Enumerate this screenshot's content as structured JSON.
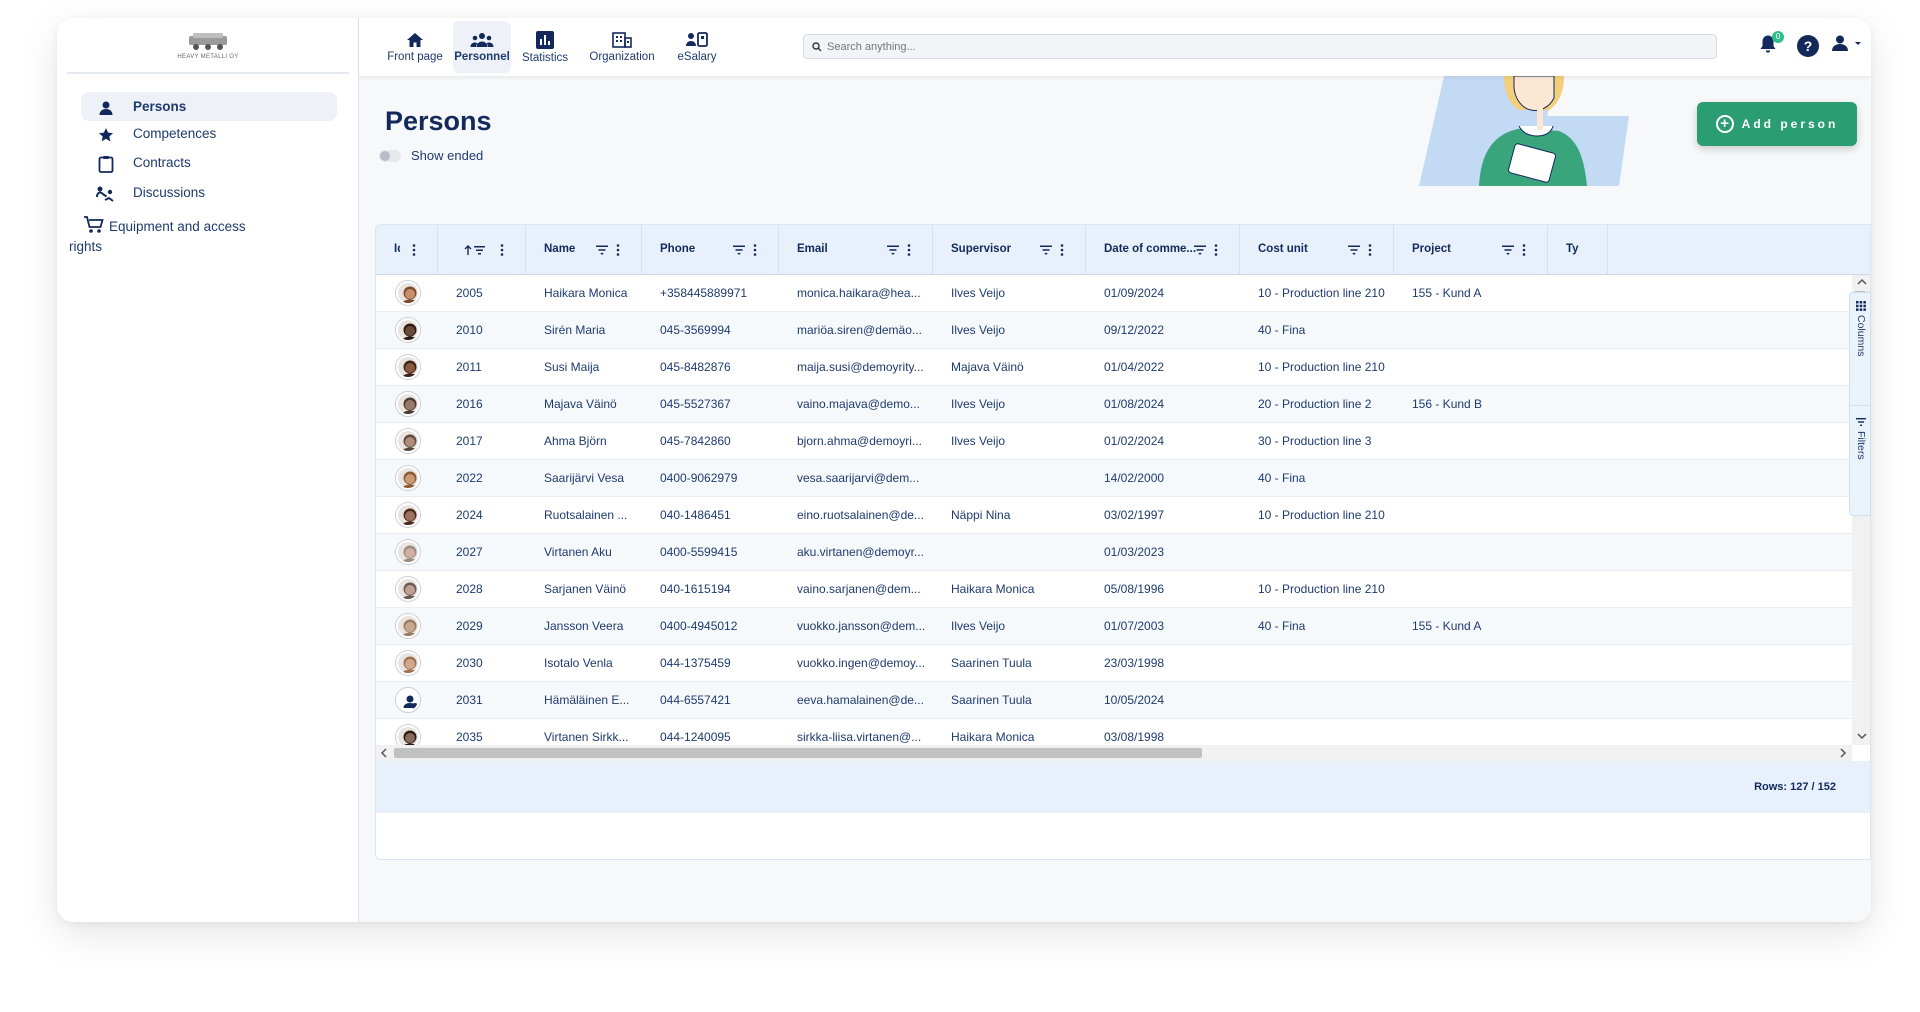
{
  "app": {
    "logo_text": "HEAVY METALLI OY"
  },
  "sidebar": {
    "items": [
      {
        "label": "Persons",
        "icon": "person-icon",
        "active": true
      },
      {
        "label": "Competences",
        "icon": "star-icon",
        "active": false
      },
      {
        "label": "Contracts",
        "icon": "clipboard-icon",
        "active": false
      },
      {
        "label": "Discussions",
        "icon": "chat-icon",
        "active": false
      },
      {
        "label": "Equipment and access rights",
        "icon": "cart-icon",
        "active": false
      }
    ]
  },
  "topnav": {
    "items": [
      {
        "label": "Front page",
        "icon": "home-icon"
      },
      {
        "label": "Personnel",
        "icon": "people-icon",
        "active": true
      },
      {
        "label": "Statistics",
        "icon": "bar-chart-icon"
      },
      {
        "label": "Organization",
        "icon": "building-icon"
      },
      {
        "label": "eSalary",
        "icon": "salary-icon"
      }
    ],
    "search_placeholder": "Search anything...",
    "notification_count": "0"
  },
  "page": {
    "title": "Persons",
    "show_ended_label": "Show ended",
    "add_person_label": "Add person"
  },
  "table": {
    "columns": [
      "Id",
      "",
      "Name",
      "Phone",
      "Email",
      "Supervisor",
      "Date of comme...",
      "Cost unit",
      "Project",
      "Ty"
    ],
    "rows": [
      {
        "no": "2005",
        "name": "Haikara Monica",
        "phone": "+358445889971",
        "email": "monica.haikara@hea...",
        "supervisor": "Ilves Veijo",
        "date": "01/09/2024",
        "cost": "10 - Production line 210",
        "project": "155 - Kund A"
      },
      {
        "no": "2010",
        "name": "Sirén Maria",
        "phone": "045-3569994",
        "email": "mariöa.siren@demäo...",
        "supervisor": "Ilves Veijo",
        "date": "09/12/2022",
        "cost": "40 - Fina",
        "project": ""
      },
      {
        "no": "2011",
        "name": "Susi Maija",
        "phone": "045-8482876",
        "email": "maija.susi@demoyrity...",
        "supervisor": "Majava Väinö",
        "date": "01/04/2022",
        "cost": "10 - Production line 210",
        "project": ""
      },
      {
        "no": "2016",
        "name": "Majava Väinö",
        "phone": "045-5527367",
        "email": "vaino.majava@demo...",
        "supervisor": "Ilves Veijo",
        "date": "01/08/2024",
        "cost": "20 - Production line 2",
        "project": "156 - Kund B"
      },
      {
        "no": "2017",
        "name": "Ahma Björn",
        "phone": "045-7842860",
        "email": "bjorn.ahma@demoyri...",
        "supervisor": "Ilves Veijo",
        "date": "01/02/2024",
        "cost": "30 - Production line 3",
        "project": ""
      },
      {
        "no": "2022",
        "name": "Saarijärvi Vesa",
        "phone": "0400-9062979",
        "email": "vesa.saarijarvi@dem...",
        "supervisor": "",
        "date": "14/02/2000",
        "cost": "40 - Fina",
        "project": ""
      },
      {
        "no": "2024",
        "name": "Ruotsalainen ...",
        "phone": "040-1486451",
        "email": "eino.ruotsalainen@de...",
        "supervisor": "Näppi Nina",
        "date": "03/02/1997",
        "cost": "10 - Production line 210",
        "project": ""
      },
      {
        "no": "2027",
        "name": "Virtanen Aku",
        "phone": "0400-5599415",
        "email": "aku.virtanen@demoyr...",
        "supervisor": "",
        "date": "01/03/2023",
        "cost": "",
        "project": ""
      },
      {
        "no": "2028",
        "name": "Sarjanen Väinö",
        "phone": "040-1615194",
        "email": "vaino.sarjanen@dem...",
        "supervisor": "Haikara Monica",
        "date": "05/08/1996",
        "cost": "10 - Production line 210",
        "project": ""
      },
      {
        "no": "2029",
        "name": "Jansson Veera",
        "phone": "0400-4945012",
        "email": "vuokko.jansson@dem...",
        "supervisor": "Ilves Veijo",
        "date": "01/07/2003",
        "cost": "40 - Fina",
        "project": "155 - Kund A"
      },
      {
        "no": "2030",
        "name": "Isotalo Venla",
        "phone": "044-1375459",
        "email": "vuokko.ingen@demoy...",
        "supervisor": "Saarinen Tuula",
        "date": "23/03/1998",
        "cost": "",
        "project": ""
      },
      {
        "no": "2031",
        "name": "Hämäläinen E...",
        "phone": "044-6557421",
        "email": "eeva.hamalainen@de...",
        "supervisor": "Saarinen Tuula",
        "date": "10/05/2024",
        "cost": "",
        "project": ""
      },
      {
        "no": "2035",
        "name": "Virtanen Sirkk...",
        "phone": "044-1240095",
        "email": "sirkka-liisa.virtanen@...",
        "supervisor": "Haikara Monica",
        "date": "03/08/1998",
        "cost": "",
        "project": ""
      }
    ],
    "rows_label": "Rows: 127 / 152"
  },
  "side_panel": {
    "columns_label": "Columns",
    "filters_label": "Filters"
  },
  "colors": {
    "primary": "#13295c",
    "accent_green": "#2a9d73",
    "header_bg": "#e8f1fb"
  }
}
